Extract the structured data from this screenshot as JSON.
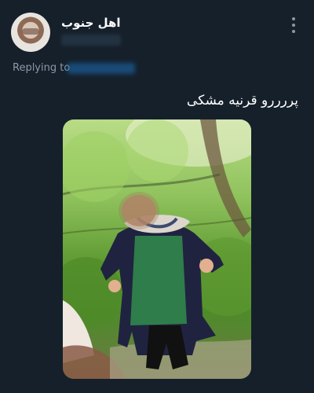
{
  "tweet": {
    "author_name": "اهل جنوب",
    "replying_label": "Replying to",
    "text": "پررررو قرنیه مشکی"
  },
  "icons": {
    "more": "more-vertical-icon",
    "avatar": "avatar"
  },
  "colors": {
    "background": "#15202b",
    "secondary_text": "#8b98a5",
    "link": "#1d9bf0"
  }
}
